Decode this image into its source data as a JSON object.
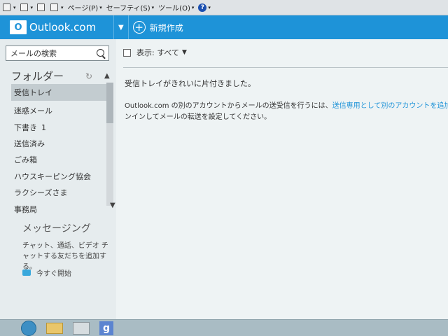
{
  "ie_toolbar": {
    "items": [
      {
        "icon": "home-icon"
      },
      {
        "icon": "rss-icon"
      },
      {
        "icon": "mail-icon"
      },
      {
        "icon": "print-icon"
      },
      {
        "label": "ページ(P)"
      },
      {
        "label": "セーフティ(S)"
      },
      {
        "label": "ツール(O)"
      },
      {
        "icon": "help-icon",
        "glyph": "?"
      }
    ]
  },
  "header": {
    "logo_text": "Outlook.com",
    "new_label": "新規作成",
    "brand_color": "#1e93d8"
  },
  "sidebar": {
    "search_placeholder": "メールの検索",
    "folders_title": "フォルダー",
    "folders": [
      {
        "label": "受信トレイ",
        "active": true
      },
      {
        "label": "迷惑メール"
      },
      {
        "label": "下書き",
        "count": "1"
      },
      {
        "label": "送信済み"
      },
      {
        "label": "ごみ箱"
      },
      {
        "label": "ハウスキーピング協会"
      },
      {
        "label": "ラクシーズさま"
      },
      {
        "label": "事務局"
      }
    ],
    "messaging_title": "メッセージング",
    "messaging_desc": "チャット、通話、ビデオ チャットする友だちを追加する。",
    "start_now": "今すぐ開始"
  },
  "main": {
    "filter_label": "表示: すべて",
    "empty_message": "受信トレイがきれいに片付きました。",
    "info_prefix": "Outlook.com の別のアカウントからメールの送受信を行うには、",
    "info_link": "送信専用として別のアカウントを追加して",
    "info_suffix": "ンインしてメールの転送を設定してください。"
  },
  "taskbar": {
    "google_glyph": "g"
  }
}
